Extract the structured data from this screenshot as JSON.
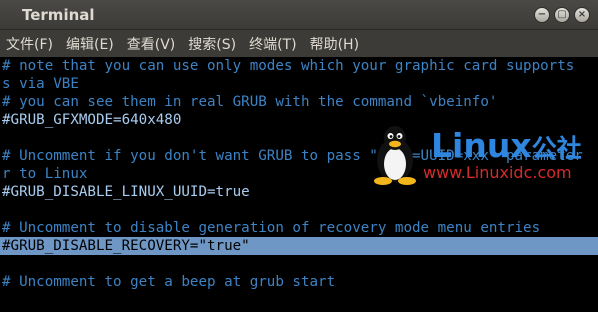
{
  "window": {
    "title": "Terminal",
    "buttons": {
      "minimize": "−",
      "maximize": "▢",
      "close": "×"
    }
  },
  "menu": [
    "文件(F)",
    "编辑(E)",
    "查看(V)",
    "搜索(S)",
    "终端(T)",
    "帮助(H)"
  ],
  "terminal": {
    "lines": [
      {
        "text": "# note that you can use only modes which your graphic card supports",
        "kind": "comment"
      },
      {
        "text": "s via VBE",
        "kind": "comment"
      },
      {
        "text": "# you can see them in real GRUB with the command `vbeinfo'",
        "kind": "comment"
      },
      {
        "text": "#GRUB_GFXMODE=640x480",
        "kind": "code"
      },
      {
        "text": "",
        "kind": "comment"
      },
      {
        "text": "# Uncomment if you don't want GRUB to pass \"root=UUID=xxx\" parameter",
        "kind": "comment"
      },
      {
        "text": "r to Linux",
        "kind": "comment"
      },
      {
        "text": "#GRUB_DISABLE_LINUX_UUID=true",
        "kind": "code"
      },
      {
        "text": "",
        "kind": "comment"
      },
      {
        "text": "# Uncomment to disable generation of recovery mode menu entries",
        "kind": "comment"
      },
      {
        "text": "#GRUB_DISABLE_RECOVERY=\"true\"",
        "kind": "selected"
      },
      {
        "text": "",
        "kind": "comment"
      },
      {
        "text": "# Uncomment to get a beep at grub start",
        "kind": "comment"
      },
      {
        "text": "",
        "kind": "comment"
      }
    ]
  },
  "watermark": {
    "brand": "Linux",
    "brand_cn": "公社",
    "url": "www.Linuxidc.com",
    "colors": {
      "brand": "#2e86de",
      "url": "#d52b2b"
    }
  },
  "colors": {
    "comment": "#3d83c4",
    "code": "#a9cdf0",
    "selection": "#6f97c6",
    "titlebar": "#3c3b37"
  }
}
